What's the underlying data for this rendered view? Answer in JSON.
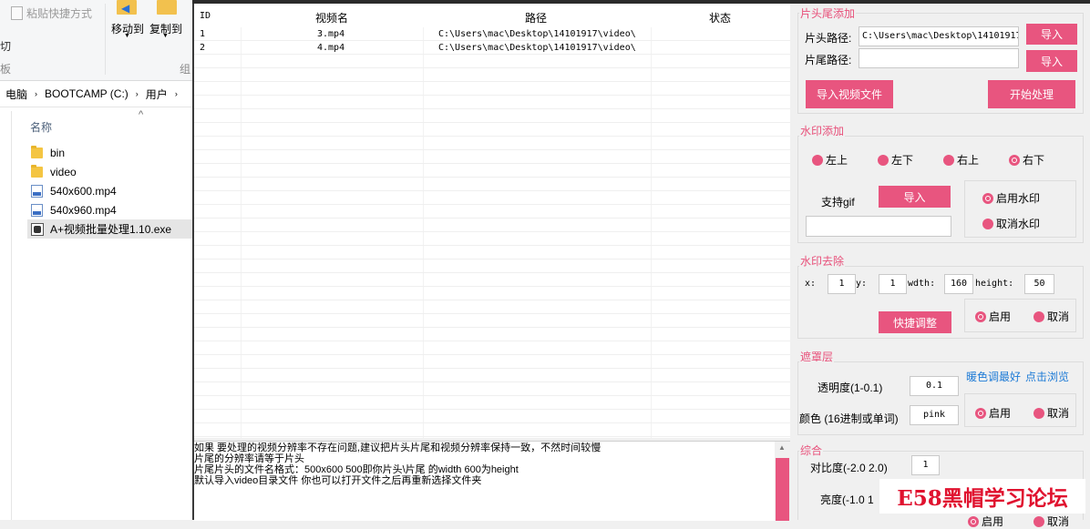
{
  "explorer": {
    "ribbon": {
      "paste_shortcut": "粘贴快捷方式",
      "cut_partial": "切",
      "clipboard_partial": "板",
      "move_to": "移动到",
      "copy_to": "复制到",
      "organize_partial": "组"
    },
    "breadcrumb": [
      "电脑",
      "BOOTCAMP (C:)",
      "用户"
    ],
    "column_name": "名称",
    "files": [
      "bin",
      "video",
      "540x600.mp4",
      "540x960.mp4",
      "A+视频批量处理1.10.exe"
    ]
  },
  "table": {
    "headers": [
      "ID",
      "视频名",
      "路径",
      "状态"
    ],
    "rows": [
      {
        "id": "1",
        "name": "3.mp4",
        "path": "C:\\Users\\mac\\Desktop\\14101917\\video\\",
        "status": ""
      },
      {
        "id": "2",
        "name": "4.mp4",
        "path": "C:\\Users\\mac\\Desktop\\14101917\\video\\",
        "status": ""
      }
    ]
  },
  "log": {
    "lines": [
      "如果 要处理的视频分辨率不存在问题,建议把片头片尾和视频分辨率保持一致，不然时间较慢",
      "片尾的分辨率请等于片头",
      "片尾片头的文件名格式：500x600 500即你片头\\片尾 的width 600为height",
      "默认导入video目录文件 你也可以打开文件之后再重新选择文件夹"
    ]
  },
  "panel": {
    "head_tail": {
      "title": "片头尾添加",
      "head_label": "片头路径:",
      "head_value": "C:\\Users\\mac\\Desktop\\14101917",
      "tail_label": "片尾路径:",
      "tail_value": "",
      "import": "导入",
      "import_video": "导入视频文件",
      "start": "开始处理"
    },
    "watermark": {
      "title": "水印添加",
      "positions": [
        "左上",
        "左下",
        "右上",
        "右下"
      ],
      "selected_position": "右下",
      "gif_label": "支持gif",
      "import": "导入",
      "gif_value": "",
      "enable": "启用水印",
      "disable": "取消水印",
      "selected_toggle": "启用水印"
    },
    "remove": {
      "title": "水印去除",
      "x_label": "x:",
      "x": "1",
      "y_label": "y:",
      "y": "1",
      "w_label": "wdth:",
      "w": "160",
      "h_label": "height:",
      "h": "50",
      "quick": "快捷调整",
      "enable": "启用",
      "cancel": "取消",
      "selected": "启用"
    },
    "mask": {
      "title": "遮罩层",
      "hint1": "暖色调最好",
      "hint2": "点击浏览",
      "opacity_label": "透明度(1-0.1)",
      "opacity": "0.1",
      "color_label": "颜色 (16进制或单词)",
      "color": "pink",
      "enable": "启用",
      "cancel": "取消",
      "selected": "启用"
    },
    "general": {
      "title": "综合",
      "contrast_label": "对比度(-2.0 2.0)",
      "contrast": "1",
      "brightness_label": "亮度(-1.0 1",
      "enable_partial": "启用",
      "cancel_partial": "取消"
    }
  },
  "watermark_overlay": "E58黑帽学习论坛",
  "colors": {
    "accent": "#e8557f",
    "background": "#f0f0f0"
  }
}
